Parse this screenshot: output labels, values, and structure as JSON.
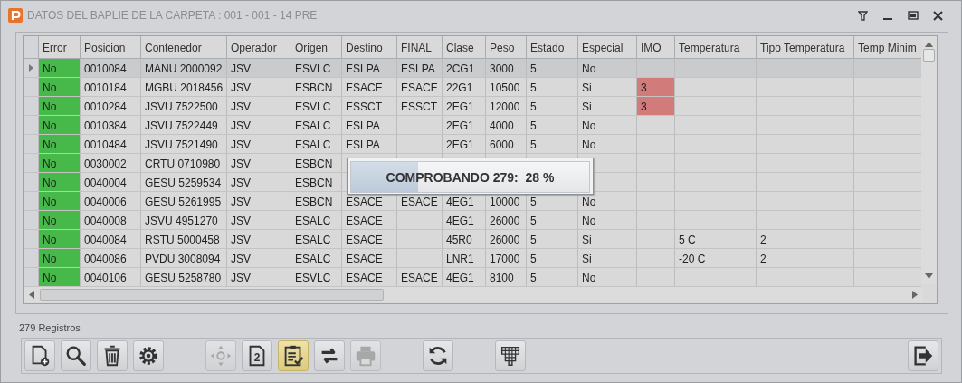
{
  "window": {
    "title": "DATOS DEL BAPLIE DE LA CARPETA : 001 - 001 - 14 PRE"
  },
  "table": {
    "columns": [
      "Error",
      "Posicion",
      "Contenedor",
      "Operador",
      "Origen",
      "Destino",
      "FINAL",
      "Clase",
      "Peso",
      "Estado",
      "Especial",
      "IMO",
      "Temperatura",
      "Tipo Temperatura",
      "Temp Minim"
    ],
    "rows": [
      {
        "selected": true,
        "cells": [
          {
            "text": "No",
            "color": "#47b84a"
          },
          "0010084",
          "MANU 2000092",
          "JSV",
          "ESVLC",
          "ESLPA",
          "ESLPA",
          "2CG1",
          "3000",
          "5",
          "No",
          null,
          null,
          null,
          null
        ]
      },
      {
        "selected": false,
        "cells": [
          {
            "text": "No",
            "color": "#47b84a"
          },
          "0010184",
          "MGBU 2018456",
          "JSV",
          "ESBCN",
          "ESACE",
          "ESACE",
          "22G1",
          "10500",
          "5",
          "Si",
          {
            "text": "3",
            "color": "#d17b7b"
          },
          null,
          null,
          null
        ]
      },
      {
        "selected": false,
        "cells": [
          {
            "text": "No",
            "color": "#47b84a"
          },
          "0010284",
          "JSVU 7522500",
          "JSV",
          "ESVLC",
          "ESSCT",
          "ESSCT",
          "2EG1",
          "12000",
          "5",
          "Si",
          {
            "text": "3",
            "color": "#d17b7b"
          },
          null,
          null,
          null
        ]
      },
      {
        "selected": false,
        "cells": [
          {
            "text": "No",
            "color": "#47b84a"
          },
          "0010384",
          "JSVU 7522449",
          "JSV",
          "ESALC",
          "ESLPA",
          null,
          "2EG1",
          "4000",
          "5",
          "No",
          null,
          null,
          null,
          null
        ]
      },
      {
        "selected": false,
        "cells": [
          {
            "text": "No",
            "color": "#47b84a"
          },
          "0010484",
          "JSVU 7521490",
          "JSV",
          "ESALC",
          "ESLPA",
          null,
          "2EG1",
          "6000",
          "5",
          "No",
          null,
          null,
          null,
          null
        ]
      },
      {
        "selected": false,
        "cells": [
          {
            "text": "No",
            "color": "#47b84a"
          },
          "0030002",
          "CRTU 0710980",
          "JSV",
          "ESBCN",
          null,
          null,
          null,
          null,
          null,
          null,
          null,
          null,
          null,
          null
        ]
      },
      {
        "selected": false,
        "cells": [
          {
            "text": "No",
            "color": "#47b84a"
          },
          "0040004",
          "GESU 5259534",
          "JSV",
          "ESBCN",
          null,
          null,
          null,
          null,
          null,
          null,
          null,
          null,
          null,
          null
        ]
      },
      {
        "selected": false,
        "cells": [
          {
            "text": "No",
            "color": "#47b84a"
          },
          "0040006",
          "GESU 5261995",
          "JSV",
          "ESBCN",
          "ESACE",
          "ESACE",
          "4EG1",
          "10000",
          "5",
          "No",
          null,
          null,
          null,
          null
        ]
      },
      {
        "selected": false,
        "cells": [
          {
            "text": "No",
            "color": "#47b84a"
          },
          "0040008",
          "JSVU 4951270",
          "JSV",
          "ESALC",
          "ESACE",
          null,
          "4EG1",
          "26000",
          "5",
          "No",
          null,
          null,
          null,
          null
        ]
      },
      {
        "selected": false,
        "cells": [
          {
            "text": "No",
            "color": "#47b84a"
          },
          "0040084",
          "RSTU 5000458",
          "JSV",
          "ESALC",
          "ESACE",
          null,
          "45R0",
          "26000",
          "5",
          "Si",
          null,
          "5 C",
          "2",
          null
        ]
      },
      {
        "selected": false,
        "cells": [
          {
            "text": "No",
            "color": "#47b84a"
          },
          "0040086",
          "PVDU 3008094",
          "JSV",
          "ESALC",
          "ESACE",
          null,
          "LNR1",
          "17000",
          "5",
          "Si",
          null,
          "-20 C",
          "2",
          null
        ]
      },
      {
        "selected": false,
        "cells": [
          {
            "text": "No",
            "color": "#47b84a"
          },
          "0040106",
          "GESU 5258780",
          "JSV",
          "ESVLC",
          "ESACE",
          "ESACE",
          "4EG1",
          "8100",
          "5",
          "No",
          null,
          null,
          null,
          null
        ]
      }
    ]
  },
  "progress": {
    "text": "COMPROBANDO 279:  28 %",
    "level": 0.28
  },
  "status": "279 Registros",
  "toolbar": [
    [
      {
        "kind": "new",
        "disabled": false,
        "selected": false
      },
      {
        "kind": "search",
        "disabled": false,
        "selected": false
      },
      {
        "kind": "delete",
        "disabled": false,
        "selected": false
      },
      {
        "kind": "settings",
        "disabled": false,
        "selected": false
      }
    ],
    [
      {
        "kind": "move",
        "disabled": true,
        "selected": false
      },
      {
        "kind": "page",
        "text": "2",
        "disabled": false,
        "selected": false
      },
      {
        "kind": "checklist",
        "disabled": false,
        "selected": true
      },
      {
        "kind": "swap",
        "disabled": false,
        "selected": false
      },
      {
        "kind": "print",
        "disabled": true,
        "selected": false
      }
    ],
    [
      {
        "kind": "refresh",
        "disabled": false,
        "selected": false
      }
    ],
    [
      {
        "kind": "grid",
        "disabled": false,
        "selected": false
      }
    ],
    [
      {
        "kind": "exit",
        "disabled": false,
        "selected": false
      }
    ]
  ]
}
